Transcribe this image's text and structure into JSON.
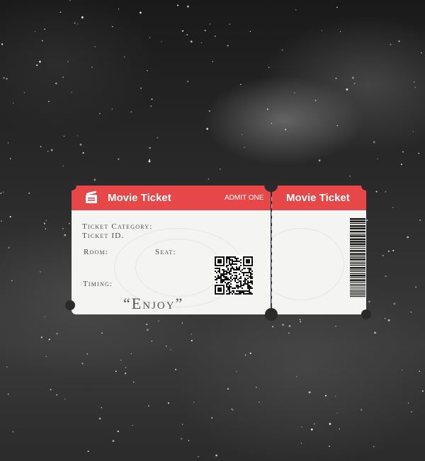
{
  "ticket": {
    "main_title": "Movie Ticket",
    "admit": "ADMIT ONE",
    "stub_title": "Movie Ticket",
    "labels": {
      "category": "Ticket Category:",
      "id": "Ticket ID.",
      "room": "Room:",
      "seat": "Seat:",
      "timing": "Timing:"
    },
    "enjoy": "“Enjoy”"
  },
  "colors": {
    "accent": "#e8474a",
    "ticket_bg": "#f4f4f2",
    "label_text": "#4a4a4a"
  },
  "icons": {
    "header_icon": "ticket-icon",
    "qr": "qr-code-icon",
    "barcode": "barcode-icon"
  }
}
